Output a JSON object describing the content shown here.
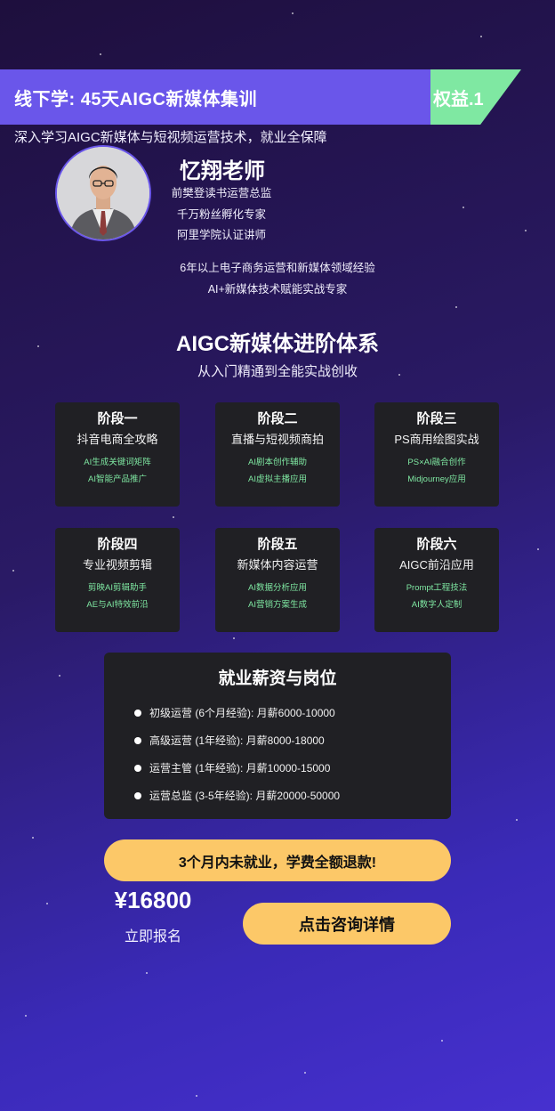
{
  "banner": {
    "title": "线下学: 45天AIGC新媒体集训",
    "benefit_tag": "权益.1",
    "subtitle": "深入学习AIGC新媒体与短视频运营技术，就业全保障"
  },
  "teacher": {
    "name": "忆翔老师",
    "titles": [
      "前樊登读书运营总监",
      "千万粉丝孵化专家",
      "阿里学院认证讲师"
    ],
    "extra": [
      "6年以上电子商务运营和新媒体领域经验",
      "AI+新媒体技术赋能实战专家"
    ]
  },
  "system": {
    "title": "AIGC新媒体进阶体系",
    "subtitle": "从入门精通到全能实战创收"
  },
  "stages": [
    {
      "name": "阶段一",
      "topic": "抖音电商全攻略",
      "points": [
        "AI生成关键词矩阵",
        "AI智能产品推广"
      ]
    },
    {
      "name": "阶段二",
      "topic": "直播与短视频商拍",
      "points": [
        "AI剧本创作辅助",
        "AI虚拟主播应用"
      ]
    },
    {
      "name": "阶段三",
      "topic": "PS商用绘图实战",
      "points": [
        "PS×AI融合创作",
        "Midjourney应用"
      ]
    },
    {
      "name": "阶段四",
      "topic": "专业视频剪辑",
      "points": [
        "剪映AI剪辑助手",
        "AE与AI特效前沿"
      ]
    },
    {
      "name": "阶段五",
      "topic": "新媒体内容运营",
      "points": [
        "AI数据分析应用",
        "AI营销方案生成"
      ]
    },
    {
      "name": "阶段六",
      "topic": "AIGC前沿应用",
      "points": [
        "Prompt工程技法",
        "AI数字人定制"
      ]
    }
  ],
  "salary": {
    "title": "就业薪资与岗位",
    "items": [
      "初级运营 (6个月经验): 月薪6000-10000",
      "高级运营 (1年经验): 月薪8000-18000",
      "运营主管 (1年经验): 月薪10000-15000",
      "运营总监 (3-5年经验): 月薪20000-50000"
    ]
  },
  "cta": {
    "guarantee": "3个月内未就业，学费全额退款!",
    "price": "¥16800",
    "enroll": "立即报名",
    "consult_button": "点击咨询详情"
  },
  "colors": {
    "banner": "#6a56ea",
    "benefit_tag": "#7fe8a2",
    "card": "#202024",
    "highlight_text": "#7fe8a2",
    "button": "#fcc868"
  },
  "icons": {
    "bullet": "bullet-dot-icon",
    "avatar": "teacher-portrait"
  }
}
